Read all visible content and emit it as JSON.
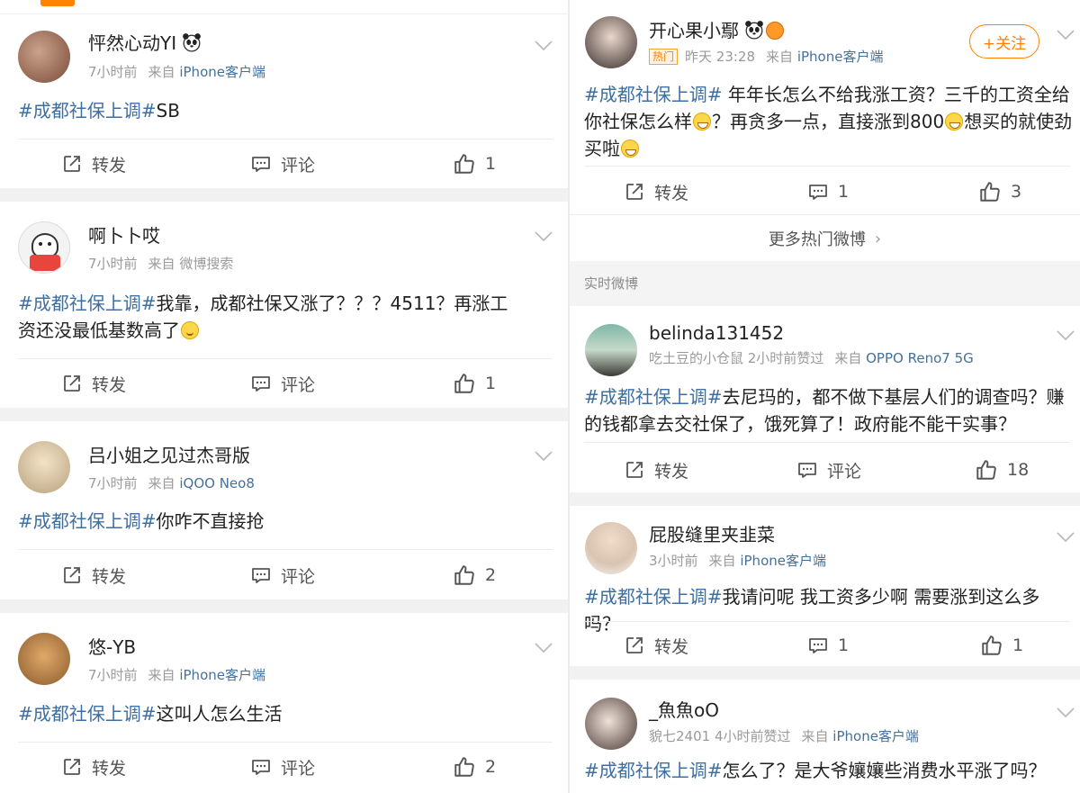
{
  "hashtag": "#成都社保上调#",
  "actions": {
    "forward": "转发",
    "comment": "评论"
  },
  "from_label": "来自",
  "left_posts": [
    {
      "name": "怦然心动YI",
      "time": "7小时前",
      "source": "iPhone客户端",
      "body": "SB",
      "comments": "",
      "likes": "1"
    },
    {
      "name": "啊卜卜哎",
      "time": "7小时前",
      "source": "微博搜索",
      "body_line1": "我靠，成都社保又涨了？？？4511？再涨工",
      "body_line2": "资还没最低基数高了",
      "comments": "",
      "likes": "1"
    },
    {
      "name": "吕小姐之见过杰哥版",
      "time": "7小时前",
      "source": "iQOO Neo8",
      "body": "你咋不直接抢",
      "comments": "",
      "likes": "2"
    },
    {
      "name": "悠-YB",
      "time": "7小时前",
      "source": "iPhone客户端",
      "body": "这叫人怎么生活",
      "comments": "",
      "likes": "2"
    }
  ],
  "hot_post": {
    "name": "开心果小鄢",
    "badge": "热门",
    "time": "昨天 23:28",
    "source": "iPhone客户端",
    "follow": "+关注",
    "line1": " 年年长怎么不给我涨工资？三千的工资全给",
    "line2a": "你社保怎么样",
    "line2b": "？再贪多一点，直接涨到800",
    "line2c": "想买的就使劲",
    "line3": "买啦",
    "comments": "1",
    "likes": "3"
  },
  "more_hot": "更多热门微博",
  "realtime_label": "实时微博",
  "right_posts": [
    {
      "name": "belinda131452",
      "meta_prefix": "吃土豆的小仓鼠 2小时前赞过",
      "source": "OPPO Reno7 5G",
      "line1": "去尼玛的，都不做下基层人们的调查吗？赚",
      "line2": "的钱都拿去交社保了，饿死算了！政府能不能干实事？",
      "comments": "",
      "likes": "18"
    },
    {
      "name": "屁股缝里夹韭菜",
      "meta_prefix": "3小时前",
      "source": "iPhone客户端",
      "body": "我请问呢 我工资多少啊 需要涨到这么多吗？",
      "comments": "1",
      "likes": "1"
    },
    {
      "name": "_魚魚oO",
      "meta_prefix": "貌七2401 4小时前赞过",
      "source": "iPhone客户端",
      "body": "怎么了？是大爷孃孃些消费水平涨了吗？"
    }
  ],
  "colors": {
    "link": "#3e6fa3",
    "accent": "#ff8200",
    "muted": "#9a9a9a"
  }
}
